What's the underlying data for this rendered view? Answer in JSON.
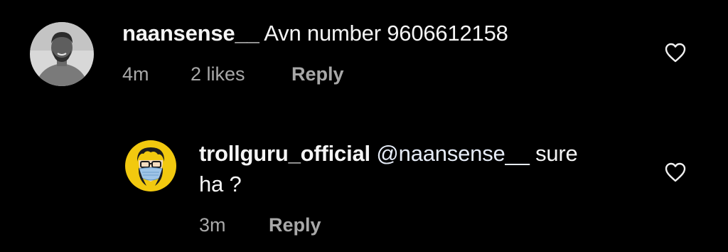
{
  "comments": [
    {
      "username": "naansense__",
      "text": "Avn number 9606612158",
      "time": "4m",
      "likes": "2 likes",
      "reply": "Reply",
      "avatar_icon": "user-photo-avatar",
      "like_icon": "heart-outline-icon"
    }
  ],
  "replies": [
    {
      "username": "trollguru_official",
      "mention": "@naansense__",
      "text_after_mention": "sure",
      "text_line2": "ha ?",
      "time": "3m",
      "reply": "Reply",
      "avatar_icon": "masked-face-cartoon-avatar",
      "like_icon": "heart-outline-icon"
    }
  ],
  "colors": {
    "background": "#000000",
    "primary_text": "#f5f5f5",
    "secondary_text": "#a8a8a8",
    "avatar_yellow": "#f2c90f"
  }
}
